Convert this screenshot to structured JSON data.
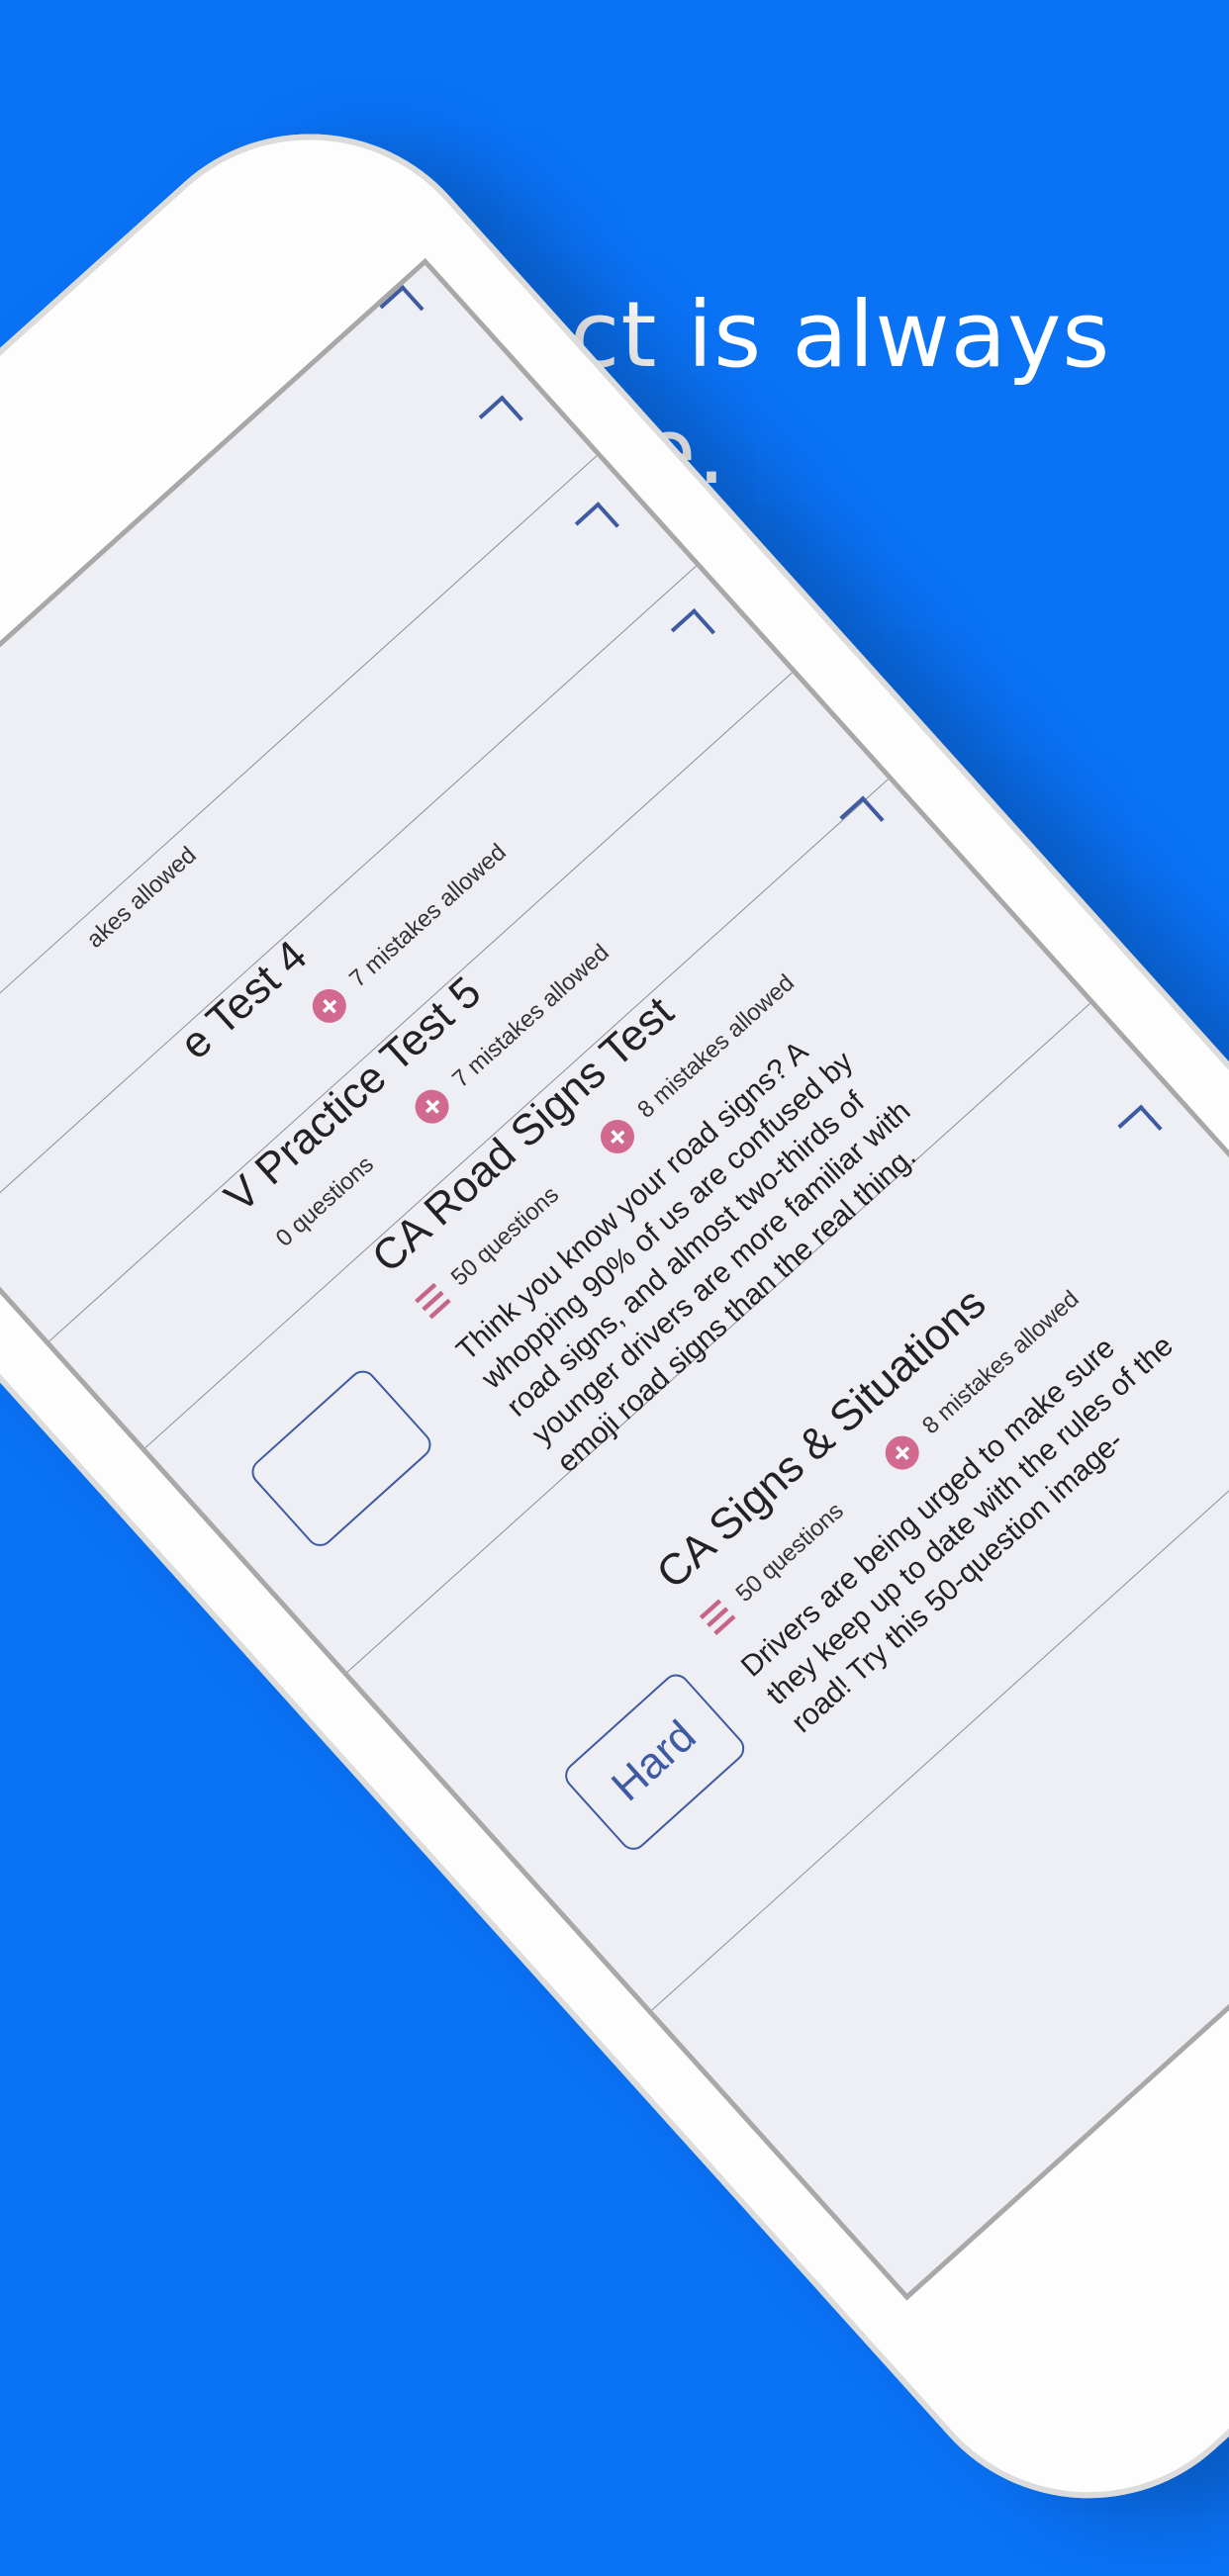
{
  "headline": {
    "line1": "The subject is always",
    "line2": "love."
  },
  "colors": {
    "background": "#0a72f5",
    "accent_pink": "#c76589",
    "accent_blue": "#3e5aa0"
  },
  "tests": [
    {
      "title": "",
      "questions": "",
      "mistakes": ""
    },
    {
      "title": "",
      "questions": "",
      "mistakes": "akes allowed"
    },
    {
      "title": "e Test 4",
      "questions": "",
      "mistakes": "7 mistakes allowed"
    },
    {
      "title": "V Practice Test 5",
      "questions": "0 questions",
      "mistakes": "7 mistakes allowed"
    },
    {
      "title": "CA Road Signs Test",
      "questions": "50 questions",
      "mistakes": "8 mistakes allowed",
      "description": "Think you know your road signs? A whopping 90% of us are confused by road signs, and almost two-thirds of younger drivers are more familiar with emoji road signs than the real thing."
    },
    {
      "title": "CA Signs & Situations",
      "questions": "50 questions",
      "mistakes": "8 mistakes allowed",
      "difficulty": "Hard",
      "description": "Drivers are being urged to make sure they keep up to date with the rules of the road! Try this 50-question image-"
    }
  ],
  "icons": {
    "questions": "list-icon",
    "mistakes": "plus-circle-icon",
    "corner": "chevron-corner-icon"
  }
}
